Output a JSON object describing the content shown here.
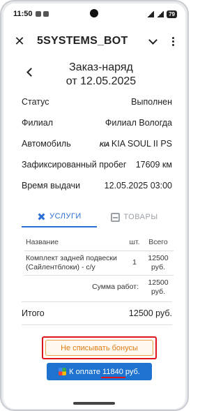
{
  "status_bar": {
    "time": "11:50",
    "battery": "79"
  },
  "app_bar": {
    "title": "5SYSTEMS_BOT"
  },
  "page": {
    "title_line1": "Заказ-наряд",
    "title_line2": "от 12.05.2025"
  },
  "info": [
    {
      "label": "Статус",
      "value": "Выполнен"
    },
    {
      "label": "Филиал",
      "value": "Филиал Вологда"
    },
    {
      "label": "Автомобиль",
      "value": "KIA SOUL II PS",
      "brand_logo": "KIA"
    },
    {
      "label": "Зафиксированный пробег",
      "value": "17609 км"
    },
    {
      "label": "Время выдачи",
      "value": "12.05.2025 03:00"
    }
  ],
  "tabs": [
    {
      "label": "УСЛУГИ",
      "icon": "tools-icon",
      "active": true
    },
    {
      "label": "ТОВАРЫ",
      "icon": "box-icon",
      "active": false
    }
  ],
  "services_table": {
    "headers": {
      "name": "Название",
      "qty": "шт.",
      "sum": "Всего"
    },
    "rows": [
      {
        "name": "Комплект задней подвески (Сайлентблоки) - с/у",
        "qty": "1",
        "sum": "12500 руб."
      }
    ],
    "total_label": "Сумма работ:",
    "total_value": "12500 руб."
  },
  "total": {
    "label": "Итого",
    "value": "12500 руб."
  },
  "buttons": {
    "bonus": "Не списывать бонусы",
    "pay_prefix": "К оплате ",
    "pay_amount": "11840",
    "pay_suffix": " руб."
  },
  "colors": {
    "accent": "#2b6fd6",
    "pay_button": "#1e73d0",
    "bonus_text": "#e07d16",
    "highlight": "#e0141b"
  }
}
